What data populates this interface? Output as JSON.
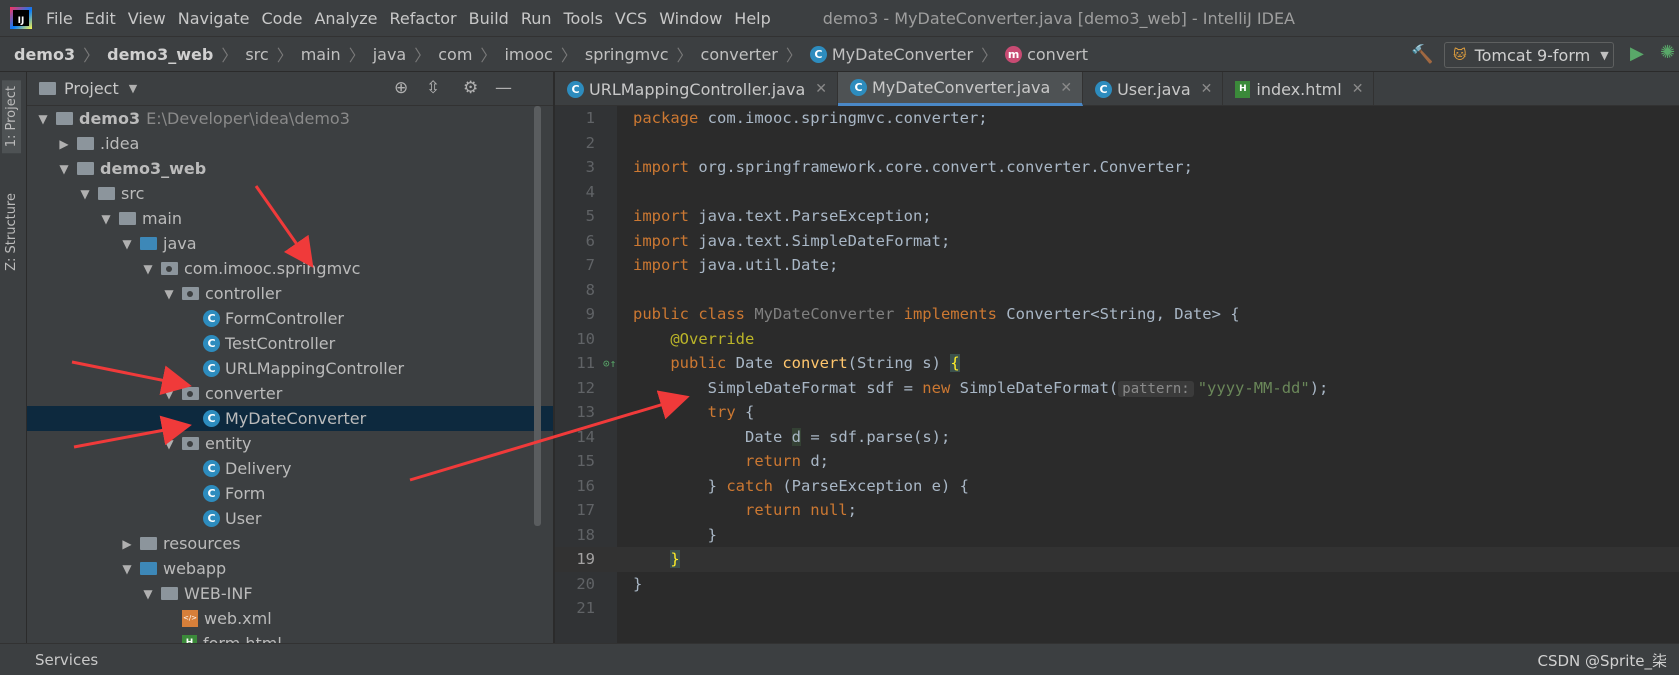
{
  "menubar": {
    "logo_text": "IJ",
    "items": [
      "File",
      "Edit",
      "View",
      "Navigate",
      "Code",
      "Analyze",
      "Refactor",
      "Build",
      "Run",
      "Tools",
      "VCS",
      "Window",
      "Help"
    ],
    "mnemonics": [
      "F",
      "E",
      "V",
      "N",
      "C",
      "z",
      "R",
      "B",
      "u",
      "T",
      "S",
      "W",
      "H"
    ],
    "window_title": "demo3 - MyDateConverter.java [demo3_web] - IntelliJ IDEA"
  },
  "navbar": {
    "breadcrumbs": [
      "demo3",
      "demo3_web",
      "src",
      "main",
      "java",
      "com",
      "imooc",
      "springmvc",
      "converter",
      "MyDateConverter",
      "convert"
    ],
    "run_config": "Tomcat 9-form"
  },
  "left_strip": {
    "project_tab": "1: Project",
    "structure_tab": "Z: Structure"
  },
  "project": {
    "title": "Project",
    "tree": [
      {
        "label": "demo3",
        "detail": "E:\\Developer\\idea\\demo3",
        "depth": 0,
        "arrow": "▼",
        "icon": "module"
      },
      {
        "label": ".idea",
        "depth": 1,
        "arrow": "▶",
        "icon": "folder"
      },
      {
        "label": "demo3_web",
        "depth": 1,
        "arrow": "▼",
        "icon": "module"
      },
      {
        "label": "src",
        "depth": 2,
        "arrow": "▼",
        "icon": "folder"
      },
      {
        "label": "main",
        "depth": 3,
        "arrow": "▼",
        "icon": "folder"
      },
      {
        "label": "java",
        "depth": 4,
        "arrow": "▼",
        "icon": "source"
      },
      {
        "label": "com.imooc.springmvc",
        "depth": 5,
        "arrow": "▼",
        "icon": "package"
      },
      {
        "label": "controller",
        "depth": 6,
        "arrow": "▼",
        "icon": "package"
      },
      {
        "label": "FormController",
        "depth": 7,
        "arrow": "",
        "icon": "class"
      },
      {
        "label": "TestController",
        "depth": 7,
        "arrow": "",
        "icon": "class"
      },
      {
        "label": "URLMappingController",
        "depth": 7,
        "arrow": "",
        "icon": "class"
      },
      {
        "label": "converter",
        "depth": 6,
        "arrow": "▼",
        "icon": "package"
      },
      {
        "label": "MyDateConverter",
        "depth": 7,
        "arrow": "",
        "icon": "class",
        "selected": true
      },
      {
        "label": "entity",
        "depth": 6,
        "arrow": "▼",
        "icon": "package"
      },
      {
        "label": "Delivery",
        "depth": 7,
        "arrow": "",
        "icon": "class"
      },
      {
        "label": "Form",
        "depth": 7,
        "arrow": "",
        "icon": "class"
      },
      {
        "label": "User",
        "depth": 7,
        "arrow": "",
        "icon": "class"
      },
      {
        "label": "resources",
        "depth": 4,
        "arrow": "▶",
        "icon": "folder"
      },
      {
        "label": "webapp",
        "depth": 4,
        "arrow": "▼",
        "icon": "source"
      },
      {
        "label": "WEB-INF",
        "depth": 5,
        "arrow": "▼",
        "icon": "folder"
      },
      {
        "label": "web.xml",
        "depth": 6,
        "arrow": "",
        "icon": "xml"
      },
      {
        "label": "form.html",
        "depth": 6,
        "arrow": "",
        "icon": "html"
      }
    ]
  },
  "editor": {
    "tabs": [
      {
        "label": "URLMappingController.java",
        "icon": "class",
        "active": false
      },
      {
        "label": "MyDateConverter.java",
        "icon": "class",
        "active": true
      },
      {
        "label": "User.java",
        "icon": "class",
        "active": false
      },
      {
        "label": "index.html",
        "icon": "html",
        "active": false
      }
    ],
    "lines": [
      "1",
      "2",
      "3",
      "4",
      "5",
      "6",
      "7",
      "8",
      "9",
      "10",
      "11",
      "12",
      "13",
      "14",
      "15",
      "16",
      "17",
      "18",
      "19",
      "20",
      "21"
    ],
    "current_line": "19",
    "code": {
      "l1_kw": "package",
      "l1_rest": " com.imooc.springmvc.converter;",
      "l3_kw": "import",
      "l3_rest": " org.springframework.core.convert.converter.Converter;",
      "l5_kw": "import",
      "l5_rest": " java.text.ParseException;",
      "l6_kw": "import",
      "l6_rest": " java.text.SimpleDateFormat;",
      "l7_kw": "import",
      "l7_rest": " java.util.Date;",
      "l9_kw1": "public class ",
      "l9_cls": "MyDateConverter",
      "l9_kw2": " implements ",
      "l9_rest": "Converter<String, Date> {",
      "l10_an": "@Override",
      "l11_kw": "public ",
      "l11_type": "Date ",
      "l11_fn": "convert",
      "l11_rest": "(String s) ",
      "l11_brace": "{",
      "l12_a": "SimpleDateFormat sdf = ",
      "l12_kw": "new ",
      "l12_b": "SimpleDateFormat(",
      "l12_hint": "pattern:",
      "l12_str": "\"yyyy-MM-dd\"",
      "l12_end": ");",
      "l13_kw": "try",
      "l13_rest": " {",
      "l14_a": "Date ",
      "l14_var": "d",
      "l14_b": " = sdf.parse(s);",
      "l15_kw": "return",
      "l15_rest": " d;",
      "l16_a": "} ",
      "l16_kw": "catch",
      "l16_rest": " (ParseException e) {",
      "l17_kw": "return null",
      "l17_rest": ";",
      "l18": "}",
      "l19_brace": "}",
      "l20": "}"
    }
  },
  "statusbar": {
    "services": "Services",
    "watermark": "CSDN @Sprite_柒"
  }
}
